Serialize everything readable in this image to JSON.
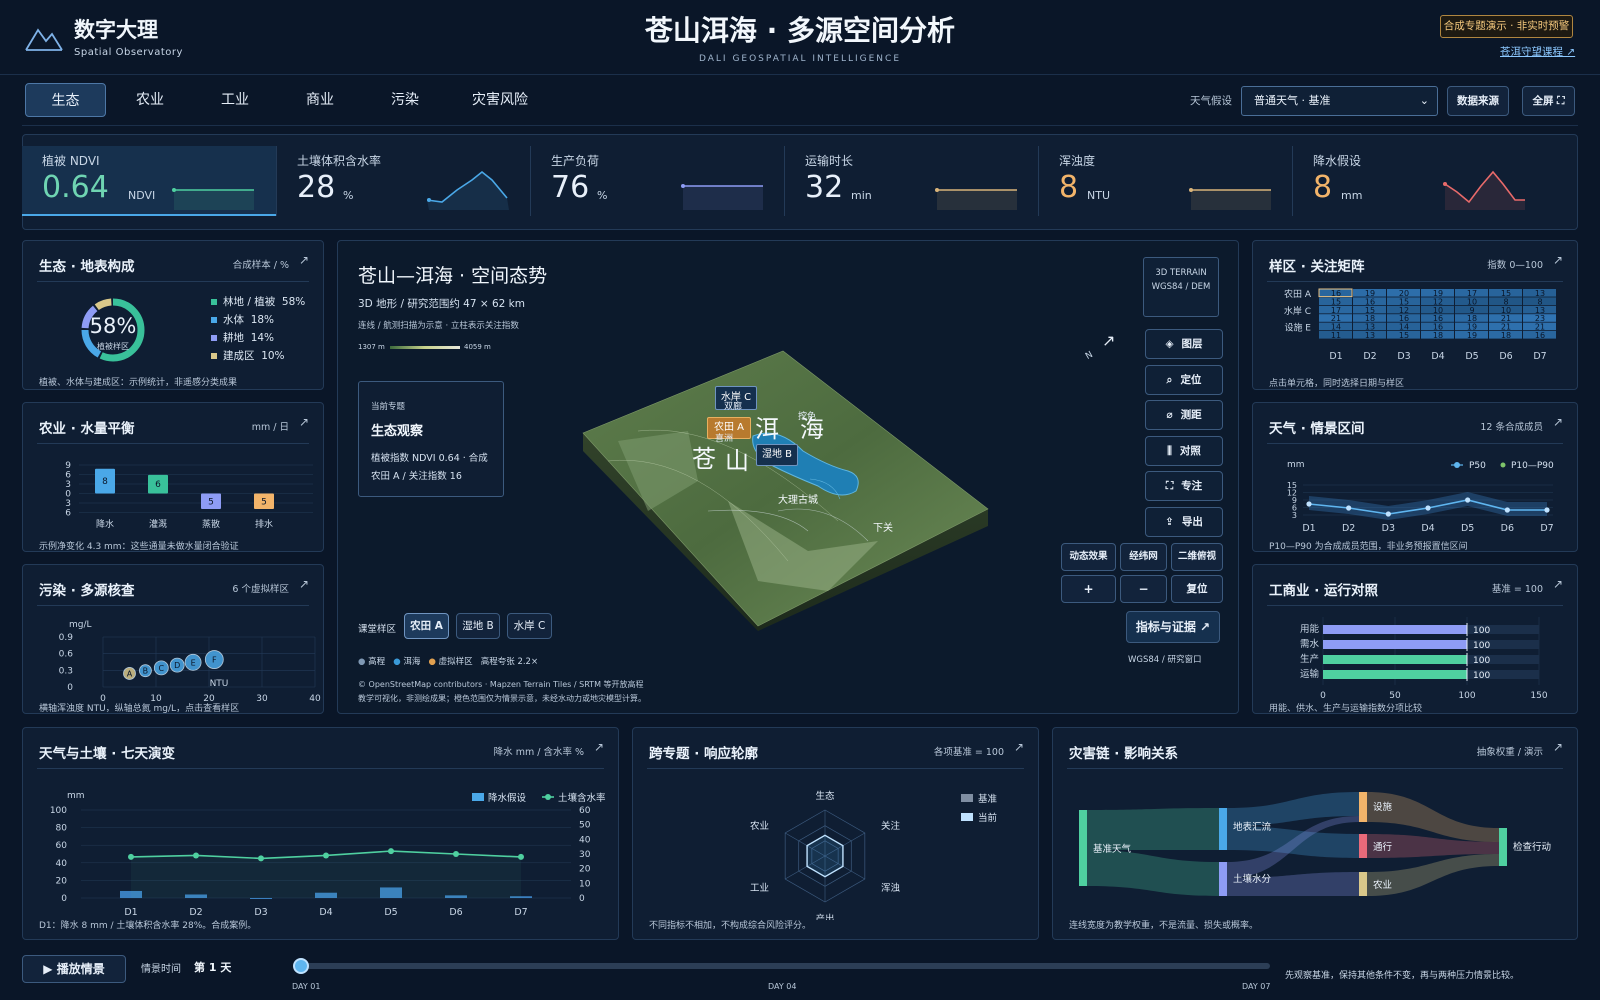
{
  "header": {
    "brand": "数字大理",
    "brand_sub": "Spatial Observatory",
    "title": "苍山洱海 · 多源空间分析",
    "subtitle": "DALI GEOSPATIAL INTELLIGENCE",
    "badge": "合成专题演示 · 非实时预警",
    "link": "苍洱守望课程 ↗"
  },
  "tabs": [
    "生态",
    "农业",
    "工业",
    "商业",
    "污染",
    "灾害风险"
  ],
  "controls": {
    "weather_label": "天气假设",
    "weather_value": "普通天气 · 基准",
    "data_source": "数据来源",
    "fullscreen": "全屏 ⛶"
  },
  "kpis": [
    {
      "label": "植被 NDVI",
      "value": "0.64",
      "unit": "NDVI",
      "color": "#6fd4b2"
    },
    {
      "label": "土壤体积含水率",
      "value": "28",
      "unit": "%",
      "color": "#e8f0fa"
    },
    {
      "label": "生产负荷",
      "value": "76",
      "unit": "%",
      "color": "#e8f0fa"
    },
    {
      "label": "运输时长",
      "value": "32",
      "unit": "min",
      "color": "#e8f0fa"
    },
    {
      "label": "浑浊度",
      "value": "8",
      "unit": "NTU",
      "color": "#f2b46a"
    },
    {
      "label": "降水假设",
      "value": "8",
      "unit": "mm",
      "color": "#f2b46a"
    }
  ],
  "eco": {
    "title": "生态 · 地表构成",
    "unit": "合成样本 / %",
    "center_value": "58%",
    "center_label": "植被样区",
    "legend": [
      {
        "name": "林地 / 植被",
        "value": "58%",
        "color": "#39c19a"
      },
      {
        "name": "水体",
        "value": "18%",
        "color": "#4aa8e8"
      },
      {
        "name": "耕地",
        "value": "14%",
        "color": "#8e9cf5"
      },
      {
        "name": "建成区",
        "value": "10%",
        "color": "#d9c88a"
      }
    ],
    "foot": "植被、水体与建成区：示例统计，非遥感分类成果"
  },
  "agri": {
    "title": "农业 · 水量平衡",
    "unit": "mm / 日",
    "foot": "示例净变化 4.3 mm：这些通量未做水量闭合验证",
    "y_ticks": [
      "9",
      "6",
      "3",
      "0",
      "3",
      "6"
    ]
  },
  "pollution": {
    "title": "污染 · 多源核查",
    "unit": "6 个虚拟样区",
    "ylabel": "mg/L",
    "xlabel": "NTU",
    "foot": "横轴浑浊度 NTU，纵轴总氮 mg/L，点击查看样区",
    "y_ticks": [
      "0.9",
      "0.6",
      "0.3",
      "0"
    ],
    "x_ticks": [
      "0",
      "10",
      "20",
      "30",
      "40"
    ]
  },
  "map": {
    "title": "苍山—洱海 · 空间态势",
    "sub": "3D 地形 / 研究范围约 47 × 62 km",
    "hint": "连线 / 航测扫描为示意 · 立柱表示关注指数",
    "scale_min": "1307 m",
    "scale_max": "4059 m",
    "badge1": "3D TERRAIN",
    "badge2": "WGS84 / DEM",
    "theme_label": "当前专题",
    "theme_title": "生态观察",
    "theme_text1": "植被指数 NDVI 0.64 · 合成",
    "theme_text2": "农田 A / 关注指数 16",
    "north": "N",
    "labels": {
      "shuian": "水岸 C",
      "shuangliang": "双廊",
      "nongtian": "农田 A",
      "xizhou": "喜洲",
      "er": "洱",
      "hai": "海",
      "wayiqiao": "挖色",
      "cang": "苍",
      "shan": "山",
      "shidi": "湿地 B",
      "gucheng": "大理古城",
      "xiaguan": "下关"
    },
    "side_buttons": [
      "图层",
      "定位",
      "测距",
      "对照",
      "专注",
      "导出"
    ],
    "small_buttons": [
      "动态效果",
      "经纬网",
      "二维俯视"
    ],
    "zoom": [
      "+",
      "−",
      "复位"
    ],
    "evidence": "指标与证据 ↗",
    "sample_label": "课堂样区",
    "samples": [
      "农田 A",
      "湿地 B",
      "水岸 C"
    ],
    "legend": [
      "高程",
      "洱海",
      "虚拟样区",
      "高程夸张 2.2×"
    ],
    "crs": "WGS84 / 研究窗口",
    "credit1": "© OpenStreetMap contributors · Mapzen Terrain Tiles / SRTM 等开放高程",
    "credit2": "教学可视化，非测绘成果；橙色范围仅为情景示意，未经水动力或地灾模型计算。"
  },
  "matrix": {
    "title": "样区 · 关注矩阵",
    "unit": "指数 0—100",
    "rows": [
      "农田 A",
      "",
      "水岸 C",
      "",
      "设施 E",
      ""
    ],
    "cols": [
      "D1",
      "D2",
      "D3",
      "D4",
      "D5",
      "D6",
      "D7"
    ],
    "values": [
      [
        16,
        19,
        20,
        19,
        17,
        15,
        13
      ],
      [
        15,
        16,
        15,
        12,
        10,
        8,
        8
      ],
      [
        17,
        15,
        12,
        10,
        9,
        10,
        13
      ],
      [
        21,
        18,
        16,
        16,
        18,
        21,
        23
      ],
      [
        14,
        13,
        14,
        16,
        19,
        21,
        21
      ],
      [
        11,
        13,
        15,
        18,
        19,
        18,
        16
      ]
    ],
    "foot": "点击单元格，同时选择日期与样区"
  },
  "weather": {
    "title": "天气 · 情景区间",
    "unit": "12 条合成成员",
    "ylabel": "mm",
    "legend_p50": "P50",
    "legend_band": "P10—P90",
    "foot": "P10—P90 为合成成员范围，非业务预报置信区间",
    "y_ticks": [
      "15",
      "12",
      "9",
      "6",
      "3"
    ],
    "x": [
      "D1",
      "D2",
      "D3",
      "D4",
      "D5",
      "D6",
      "D7"
    ],
    "p50": [
      8,
      6,
      3,
      6,
      10,
      5,
      5
    ]
  },
  "industry": {
    "title": "工商业 · 运行对照",
    "unit": "基准 = 100",
    "rows": [
      {
        "name": "用能",
        "value": 100,
        "color": "#8e9cf5"
      },
      {
        "name": "需水",
        "value": 100,
        "color": "#8e9cf5"
      },
      {
        "name": "生产",
        "value": 100,
        "color": "#4fd0a0"
      },
      {
        "name": "运输",
        "value": 100,
        "color": "#4fd0a0"
      }
    ],
    "x_ticks": [
      "0",
      "50",
      "100",
      "150"
    ],
    "foot": "用能、供水、生产与运输指数分项比较"
  },
  "seven": {
    "title": "天气与土壤 · 七天演变",
    "unit": "降水 mm / 含水率 %",
    "ylabel": "mm",
    "legend_rain": "降水假设",
    "legend_soil": "土壤含水率",
    "x": [
      "D1",
      "D2",
      "D3",
      "D4",
      "D5",
      "D6",
      "D7"
    ],
    "rain": [
      8,
      4,
      0,
      6,
      12,
      3,
      2
    ],
    "soil": [
      28,
      29,
      27,
      29,
      32,
      30,
      28
    ],
    "y_left": [
      "100",
      "80",
      "60",
      "40",
      "20",
      "0"
    ],
    "y_right": [
      "60",
      "50",
      "40",
      "30",
      "20",
      "10",
      "0"
    ],
    "foot": "D1：降水 8 mm / 土壤体积含水率 28%。合成案例。"
  },
  "radar": {
    "title": "跨专题 · 响应轮廓",
    "unit": "各项基准 = 100",
    "axes": [
      "生态",
      "关注",
      "浑浊",
      "产出",
      "工业",
      "农业"
    ],
    "legend_base": "基准",
    "legend_now": "当前",
    "foot": "不同指标不相加，不构成综合风险评分。"
  },
  "sankey": {
    "title": "灾害链 · 影响关系",
    "unit": "抽象权重 / 演示",
    "nodes": [
      "基准天气",
      "地表汇流",
      "土壤水分",
      "设施",
      "通行",
      "农业",
      "检查行动"
    ],
    "foot": "连线宽度为教学权重，不是流量、损失或概率。"
  },
  "timeline": {
    "play": "▶ 播放情景",
    "time_label": "情景时间",
    "time_value": "第 1 天",
    "start": "DAY 01",
    "mid": "DAY 04",
    "end": "DAY 07",
    "note": "先观察基准，保持其他条件不变，再与两种压力情景比较。"
  }
}
